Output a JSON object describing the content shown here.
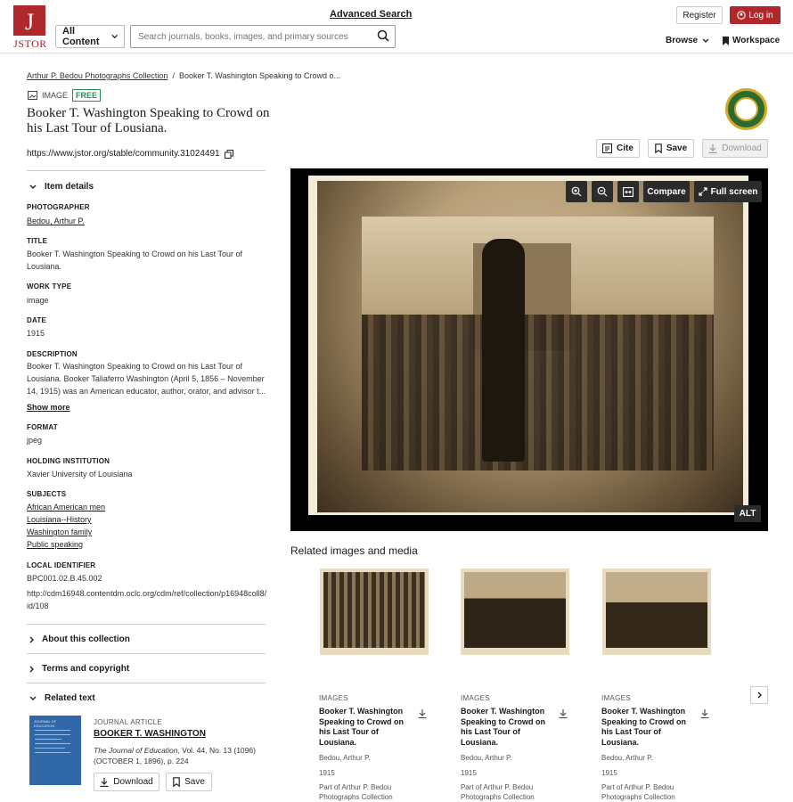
{
  "header": {
    "logo_text": "JSTOR",
    "advanced_search": "Advanced Search",
    "content_select": "All Content",
    "search_placeholder": "Search journals, books, images, and primary sources",
    "register": "Register",
    "login": "Log in",
    "browse": "Browse",
    "workspace": "Workspace"
  },
  "breadcrumb": {
    "collection": "Arthur P. Bedou Photographs Collection",
    "current": "Booker T. Washington Speaking to Crowd o..."
  },
  "item": {
    "type": "IMAGE",
    "free_badge": "FREE",
    "title": "Booker T. Washington Speaking to Crowd on his Last Tour of Lousiana.",
    "url": "https://www.jstor.org/stable/community.31024491",
    "actions": {
      "cite": "Cite",
      "save": "Save",
      "download": "Download"
    }
  },
  "details": {
    "toggle": "Item details",
    "photographer_label": "PHOTOGRAPHER",
    "photographer": "Bedou, Arthur P.",
    "title_label": "TITLE",
    "title": "Booker T. Washington Speaking to Crowd on his Last Tour of Lousiana.",
    "work_type_label": "WORK TYPE",
    "work_type": "image",
    "date_label": "DATE",
    "date": "1915",
    "description_label": "DESCRIPTION",
    "description": "Booker T. Washington Speaking to Crowd on his Last Tour of Lousiana. Booker Taliaferro Washington (April 5, 1856 – November 14, 1915) was an American educator, author, orator, and advisor t...",
    "show_more": "Show more",
    "format_label": "FORMAT",
    "format": "jpeg",
    "holding_label": "HOLDING INSTITUTION",
    "holding": "Xavier University of Louisiana",
    "subjects_label": "SUBJECTS",
    "subjects": [
      "African American men",
      "Louisiana--History",
      "Washington family",
      "Public speaking"
    ],
    "local_id_label": "LOCAL IDENTIFIER",
    "local_id": "BPC001.02.B.45.002",
    "local_url": "http://cdm16948.contentdm.oclc.org/cdm/ref/collection/p16948coll8/id/108"
  },
  "sections": {
    "about": "About this collection",
    "terms": "Terms and copyright",
    "related_text": "Related text"
  },
  "viewer": {
    "compare": "Compare",
    "fullscreen": "Full screen",
    "alt": "ALT"
  },
  "related": {
    "heading": "Related images and media",
    "cards": [
      {
        "type": "IMAGES",
        "title": "Booker T. Washington Speaking to Crowd on his Last Tour of Lousiana.",
        "author": "Bedou, Arthur P.",
        "date": "1915",
        "part_of": "Part of Arthur P. Bedou Photographs Collection"
      },
      {
        "type": "IMAGES",
        "title": "Booker T. Washington Speaking to Crowd on his Last Tour of Lousiana.",
        "author": "Bedou, Arthur P.",
        "date": "1915",
        "part_of": "Part of Arthur P. Bedou Photographs Collection"
      },
      {
        "type": "IMAGES",
        "title": "Booker T. Washington Speaking to Crowd on his Last Tour of Lousiana.",
        "author": "Bedou, Arthur P.",
        "date": "1915",
        "part_of": "Part of Arthur P. Bedou Photographs Collection"
      }
    ]
  },
  "related_text": {
    "type": "JOURNAL ARTICLE",
    "title": "BOOKER T. WASHINGTON",
    "journal": "The Journal of Education",
    "citation": ", Vol. 44, No. 13 (1096) (OCTOBER 1, 1896), p. 224",
    "download": "Download",
    "save": "Save",
    "thumb_title": "JOURNAL OF EDUCATION"
  },
  "colors": {
    "brand": "#b0282b",
    "free": "#2e8b57"
  }
}
